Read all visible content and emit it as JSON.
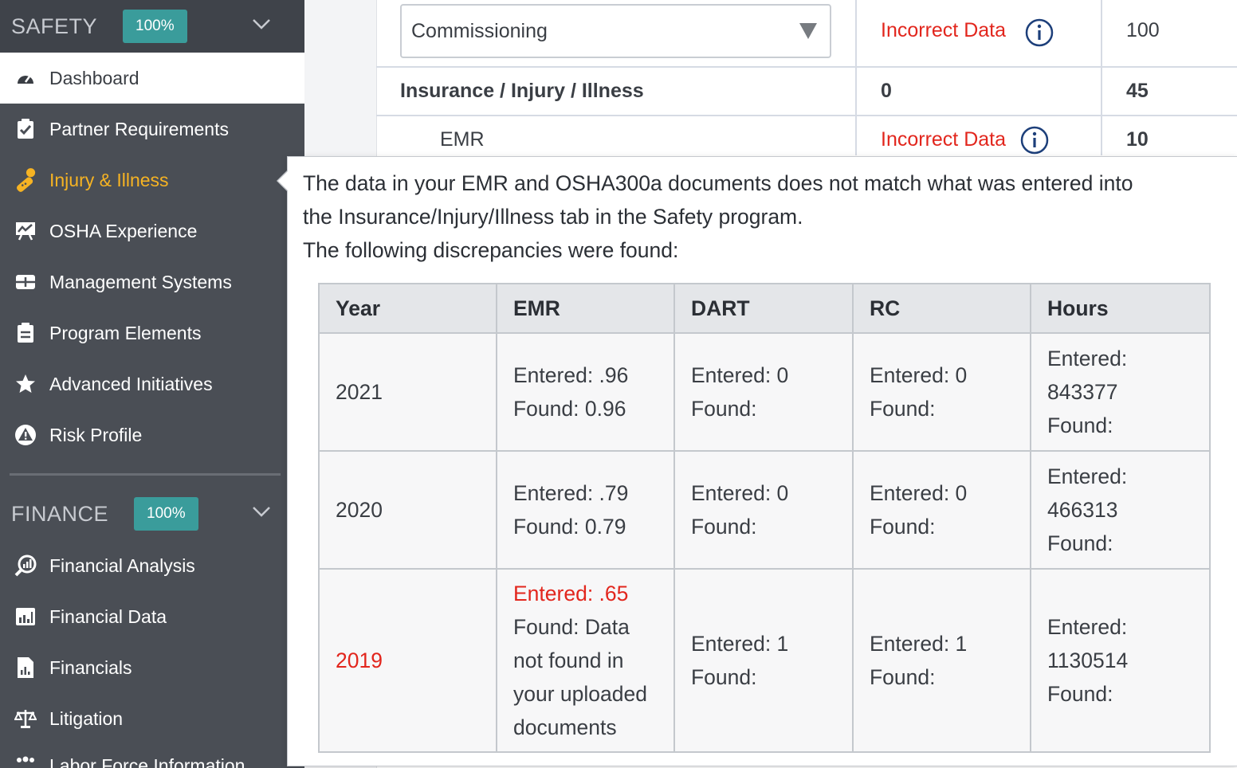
{
  "sidebar": {
    "safety": {
      "title": "SAFETY",
      "badge": "100%"
    },
    "items": [
      {
        "label": "Dashboard",
        "icon": "dashboard-gauge-icon"
      },
      {
        "label": "Partner Requirements",
        "icon": "clipboard-check-icon"
      },
      {
        "label": "Injury & Illness",
        "icon": "bandage-icon"
      },
      {
        "label": "OSHA Experience",
        "icon": "chart-board-icon"
      },
      {
        "label": "Management Systems",
        "icon": "management-list-icon"
      },
      {
        "label": "Program Elements",
        "icon": "clipboard-list-icon"
      },
      {
        "label": "Advanced Initiatives",
        "icon": "star-icon"
      },
      {
        "label": "Risk Profile",
        "icon": "warning-circle-icon"
      }
    ],
    "finance": {
      "title": "FINANCE",
      "badge": "100%"
    },
    "finance_items": [
      {
        "label": "Financial Analysis",
        "icon": "analysis-magnifier-icon"
      },
      {
        "label": "Financial Data",
        "icon": "bar-chart-icon"
      },
      {
        "label": "Financials",
        "icon": "document-chart-icon"
      },
      {
        "label": "Litigation",
        "icon": "scales-icon"
      },
      {
        "label": "Labor Force Information",
        "icon": "people-icon"
      }
    ]
  },
  "main": {
    "dropdown_value": "Commissioning",
    "row1": {
      "status": "Incorrect Data",
      "score": "100"
    },
    "row2": {
      "label": "Insurance / Injury / Illness",
      "value": "0",
      "score": "45"
    },
    "row3": {
      "label": "EMR",
      "status": "Incorrect Data",
      "score": "10"
    }
  },
  "popover": {
    "line1": "The data in your EMR and OSHA300a documents does not match what was entered into",
    "line2": "the Insurance/Injury/Illness tab in the Safety program.",
    "line3": "The following discrepancies were found:",
    "headers": [
      "Year",
      "EMR",
      "DART",
      "RC",
      "Hours"
    ],
    "rows": [
      {
        "year": "2021",
        "emr": [
          "Entered: .96",
          "Found: 0.96"
        ],
        "dart": [
          "Entered: 0",
          "Found:"
        ],
        "rc": [
          "Entered: 0",
          "Found:"
        ],
        "hours": [
          "Entered:",
          "843377",
          "Found:"
        ]
      },
      {
        "year": "2020",
        "emr": [
          "Entered: .79",
          "Found: 0.79"
        ],
        "dart": [
          "Entered: 0",
          "Found:"
        ],
        "rc": [
          "Entered: 0",
          "Found:"
        ],
        "hours": [
          "Entered:",
          "466313",
          "Found:"
        ]
      },
      {
        "year": "2019",
        "emr_red": "Entered: .65",
        "emr": [
          "Found: Data",
          "not found in",
          "your uploaded",
          "documents"
        ],
        "dart": [
          "Entered: 1",
          "Found:"
        ],
        "rc": [
          "Entered: 1",
          "Found:"
        ],
        "hours": [
          "Entered:",
          "1130514",
          "Found:"
        ]
      }
    ]
  },
  "colors": {
    "accent_teal": "#3a9c9b",
    "error_red": "#e2261d",
    "active_yellow": "#f6b323",
    "sidebar_bg": "#4a4e55"
  }
}
